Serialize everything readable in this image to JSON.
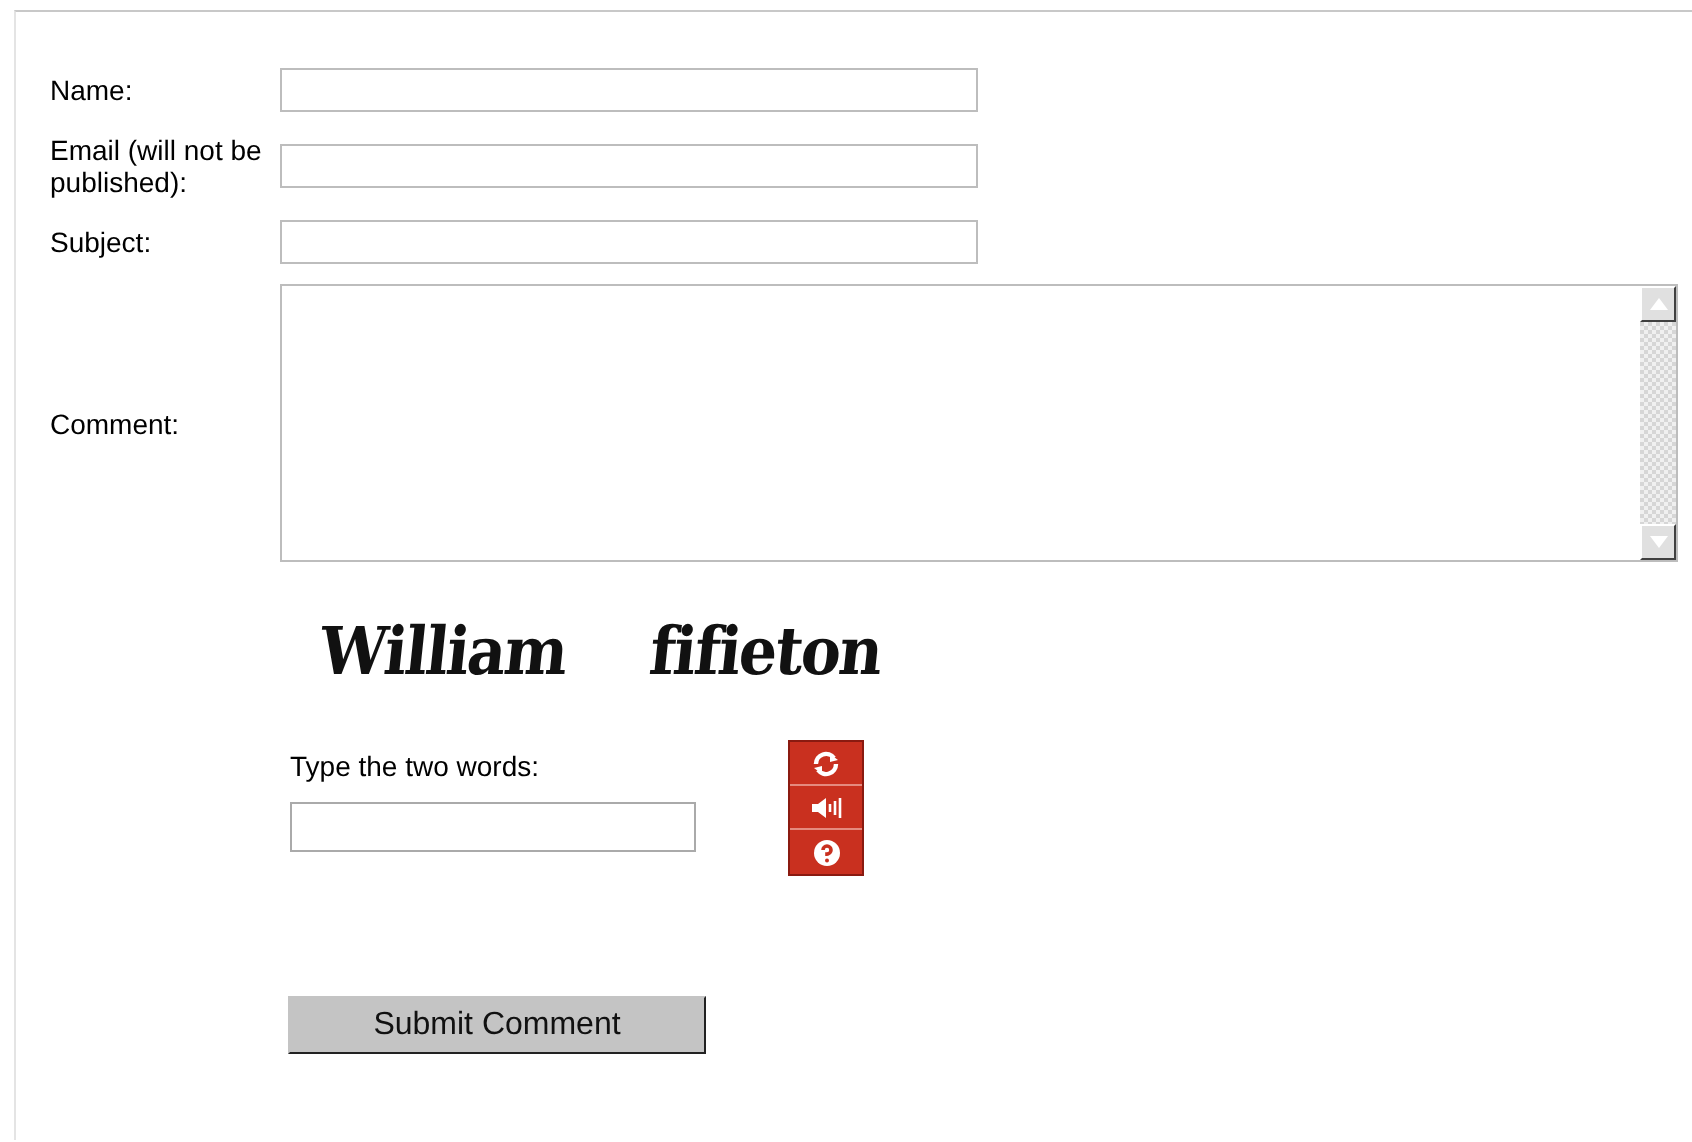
{
  "fields": [
    {
      "label": "Name:",
      "kind": "text"
    },
    {
      "label": "Email (will not be published):",
      "kind": "text"
    },
    {
      "label": "Subject:",
      "kind": "text"
    },
    {
      "label": "Comment:",
      "kind": "textarea"
    }
  ],
  "captcha": {
    "words": [
      "William",
      "fifieton"
    ],
    "prompt": "Type the two words:"
  },
  "submit": "Submit Comment"
}
